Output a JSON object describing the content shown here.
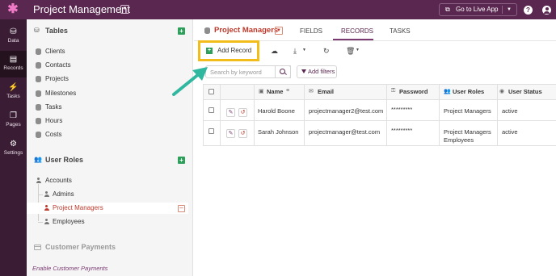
{
  "app": {
    "title": "Project Management",
    "live_button": "Go to Live App"
  },
  "icons": {
    "logo": "asterisk-logo-icon",
    "help": "help-icon",
    "user": "user-account-icon"
  },
  "leftnav": [
    {
      "label": "Data",
      "icon": "data-icon"
    },
    {
      "label": "Records",
      "icon": "records-icon"
    },
    {
      "label": "Tasks",
      "icon": "tasks-icon"
    },
    {
      "label": "Pages",
      "icon": "pages-icon"
    },
    {
      "label": "Settings",
      "icon": "gear-icon"
    }
  ],
  "sidebar": {
    "tables_title": "Tables",
    "tables": [
      "Clients",
      "Contacts",
      "Projects",
      "Milestones",
      "Tasks",
      "Hours",
      "Costs"
    ],
    "roles_title": "User Roles",
    "roles": [
      "Accounts",
      "Admins",
      "Project Managers",
      "Employees"
    ],
    "active_role": "Project Managers",
    "customer_payments_title": "Customer Payments",
    "enable_link": "Enable Customer Payments"
  },
  "main": {
    "title": "Project Managers",
    "tabs": [
      "FIELDS",
      "RECORDS",
      "TASKS"
    ],
    "active_tab": "RECORDS",
    "add_record": "Add Record",
    "search_placeholder": "Search by keyword",
    "add_filters": "Add filters",
    "columns": [
      "Name",
      "Email",
      "Password",
      "User Roles",
      "User Status"
    ],
    "rows": [
      {
        "name": "Harold Boone",
        "email": "projectmanager2@test.com",
        "password": "*********",
        "roles": "Project Managers",
        "roles_2": "",
        "status": "active"
      },
      {
        "name": "Sarah Johnson",
        "email": "projectmanager@test.com",
        "password": "*********",
        "roles": "Project Managers",
        "roles_2": "Employees",
        "status": "active"
      }
    ]
  },
  "colors": {
    "topbar": "#5a2750",
    "leftnav": "#3a1d34",
    "accent": "#c0392b",
    "add_green": "#2e9e5b",
    "highlight": "#f2bd1a",
    "arrow": "#2fb7a0"
  }
}
